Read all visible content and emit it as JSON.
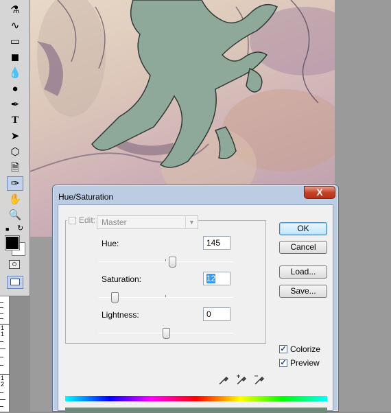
{
  "dialog": {
    "title": "Hue/Saturation",
    "close_label": "X",
    "edit_label": "Edit:",
    "edit_value": "Master",
    "hue": {
      "label": "Hue:",
      "value": "145",
      "slider_fraction": 0.55
    },
    "saturation": {
      "label": "Saturation:",
      "value": "12",
      "slider_fraction": 0.12
    },
    "lightness": {
      "label": "Lightness:",
      "value": "0",
      "slider_fraction": 0.5
    },
    "buttons": {
      "ok": "OK",
      "cancel": "Cancel",
      "load": "Load...",
      "save": "Save..."
    },
    "colorize": {
      "label": "Colorize",
      "checked": true
    },
    "preview": {
      "label": "Preview",
      "checked": true
    },
    "result_color": "#6f8a7a"
  },
  "toolbox": {
    "tools": [
      "stamp-icon",
      "history-brush-icon",
      "eraser-icon",
      "paint-bucket-icon",
      "blur-drop-icon",
      "dodge-icon",
      "pen-icon",
      "type-icon",
      "path-select-icon",
      "custom-shape-icon",
      "notes-icon",
      "eyedropper-icon",
      "hand-icon",
      "zoom-icon"
    ],
    "type_glyph": "T",
    "foreground": "#000000",
    "background": "#ffffff"
  },
  "ruler": {
    "numbers": [
      "1",
      "1",
      "1",
      "2"
    ]
  }
}
